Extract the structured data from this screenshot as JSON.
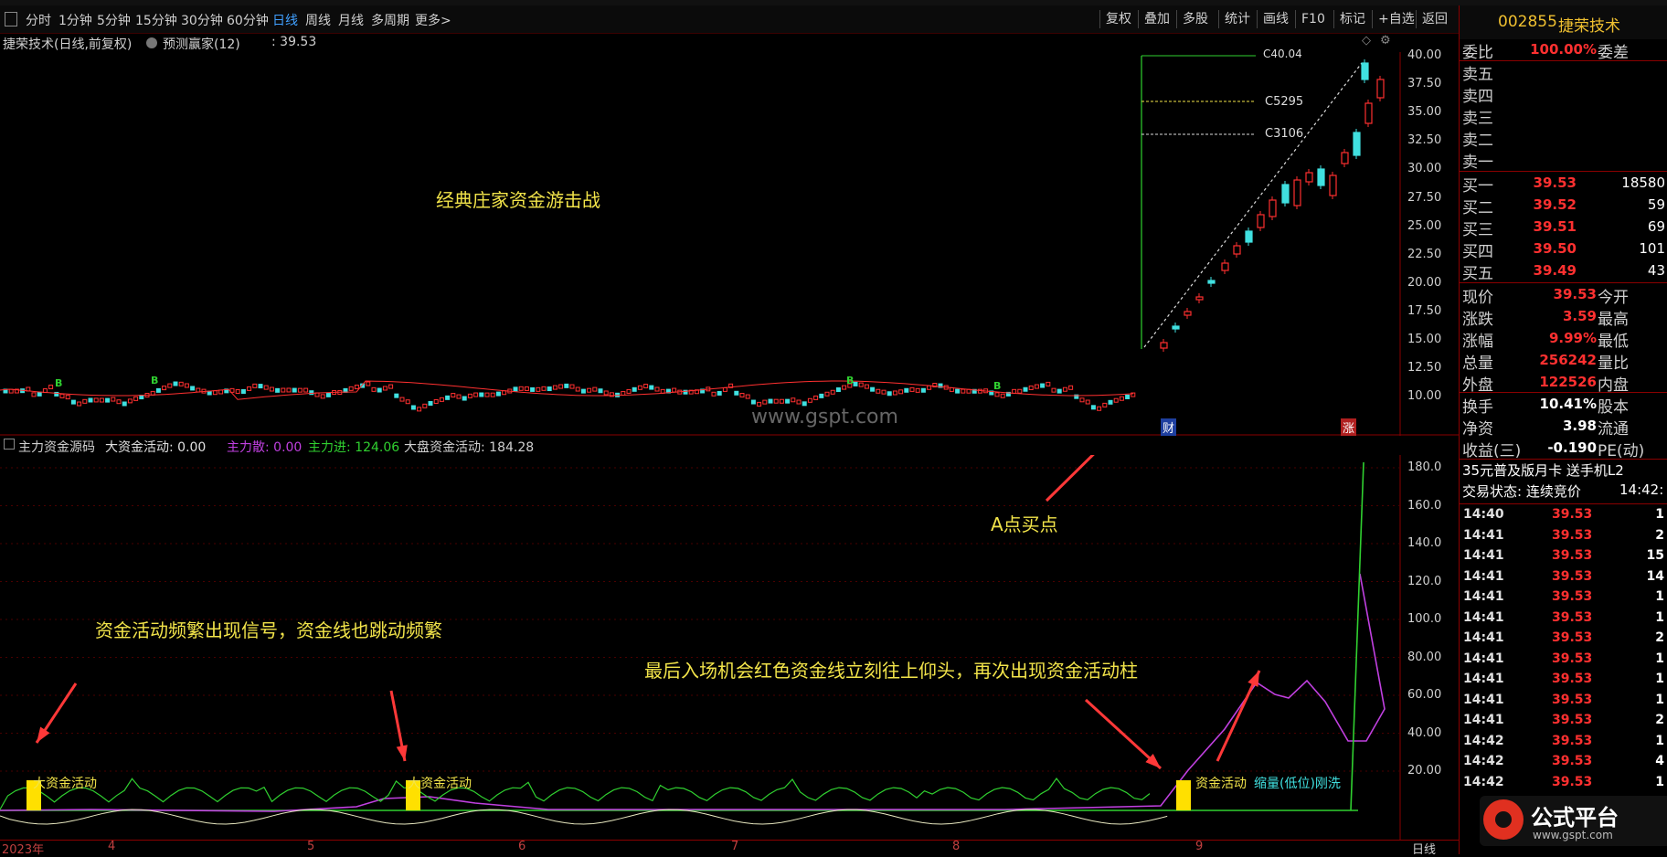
{
  "toolbar": {
    "periods": [
      "分时",
      "1分钟",
      "5分钟",
      "15分钟",
      "30分钟",
      "60分钟",
      "日线",
      "周线",
      "月线",
      "多周期",
      "更多>"
    ],
    "active_period": "日线",
    "right_buttons": [
      "复权",
      "叠加",
      "多股",
      "统计",
      "画线",
      "F10",
      "标记",
      "+自选",
      "返回"
    ]
  },
  "stock": {
    "code": "002855",
    "name": "捷荣技术"
  },
  "main_chart": {
    "title": "捷荣技术(日线,前复权)",
    "indicator": "预测赢家(12)",
    "indicator_value": ": 39.53",
    "watermark": "www.gspt.com",
    "annotation": "经典庄家资金游击战",
    "level_labels": [
      "C40.04",
      "C5295",
      "C3106"
    ],
    "b_label": "B",
    "marker_cai": "财",
    "marker_zhang": "涨",
    "y_ticks": [
      "40.00",
      "37.50",
      "35.00",
      "32.50",
      "30.00",
      "27.50",
      "25.00",
      "22.50",
      "20.00",
      "17.50",
      "15.00",
      "12.50",
      "10.00"
    ]
  },
  "sub_chart": {
    "title": "主力资金源码",
    "big_fund_label": "大资金活动: 0.00",
    "main_scatter": "主力散: 0.00",
    "main_in": "主力进: 124.06",
    "market_fund": "大盘资金活动: 184.28",
    "y_ticks": [
      "180.0",
      "160.0",
      "140.0",
      "120.0",
      "100.0",
      "80.00",
      "60.00",
      "40.00",
      "20.00"
    ],
    "bar_labels": [
      "大资金活动",
      "大资金活动",
      "资金活动"
    ],
    "shrink_label": "缩量(低位)刚洗",
    "annotation_buy": "A点买点",
    "annotation_left": "资金活动频繁出现信号，资金线也跳动频繁",
    "annotation_right": "最后入场机会红色资金线立刻往上仰头，再次出现资金活动柱"
  },
  "x_axis": {
    "labels": [
      "2023年",
      "4",
      "5",
      "6",
      "7",
      "8",
      "9"
    ],
    "period_label": "日线"
  },
  "quote": {
    "weibi": {
      "k": "委比",
      "v": "100.00%",
      "k2": "委差"
    },
    "sells": [
      "卖五",
      "卖四",
      "卖三",
      "卖二",
      "卖一"
    ],
    "buys": [
      {
        "k": "买一",
        "p": "39.53",
        "q": "18580"
      },
      {
        "k": "买二",
        "p": "39.52",
        "q": "59"
      },
      {
        "k": "买三",
        "p": "39.51",
        "q": "69"
      },
      {
        "k": "买四",
        "p": "39.50",
        "q": "101"
      },
      {
        "k": "买五",
        "p": "39.49",
        "q": "43"
      }
    ],
    "stats": [
      {
        "k": "现价",
        "v": "39.53",
        "k2": "今开"
      },
      {
        "k": "涨跌",
        "v": "3.59",
        "k2": "最高"
      },
      {
        "k": "涨幅",
        "v": "9.99%",
        "k2": "最低"
      },
      {
        "k": "总量",
        "v": "256242",
        "k2": "量比"
      },
      {
        "k": "外盘",
        "v": "122526",
        "k2": "内盘"
      }
    ],
    "stats2": [
      {
        "k": "换手",
        "v": "10.41%",
        "k2": "股本"
      },
      {
        "k": "净资",
        "v": "3.98",
        "k2": "流通"
      },
      {
        "k": "收益(三)",
        "v": "-0.190",
        "k2": "PE(动)"
      }
    ],
    "promo": "35元普及版月卡 送手机L2",
    "trade_status": "交易状态: 连续竞价",
    "trade_time": "14:42:",
    "ticks": [
      {
        "t": "14:40",
        "p": "39.53",
        "q": "1"
      },
      {
        "t": "14:41",
        "p": "39.53",
        "q": "2"
      },
      {
        "t": "14:41",
        "p": "39.53",
        "q": "15"
      },
      {
        "t": "14:41",
        "p": "39.53",
        "q": "14"
      },
      {
        "t": "14:41",
        "p": "39.53",
        "q": "1"
      },
      {
        "t": "14:41",
        "p": "39.53",
        "q": "1"
      },
      {
        "t": "14:41",
        "p": "39.53",
        "q": "2"
      },
      {
        "t": "14:41",
        "p": "39.53",
        "q": "1"
      },
      {
        "t": "14:41",
        "p": "39.53",
        "q": "1"
      },
      {
        "t": "14:41",
        "p": "39.53",
        "q": "1"
      },
      {
        "t": "14:41",
        "p": "39.53",
        "q": "2"
      },
      {
        "t": "14:42",
        "p": "39.53",
        "q": "1"
      },
      {
        "t": "14:42",
        "p": "39.53",
        "q": "4"
      },
      {
        "t": "14:42",
        "p": "39.53",
        "q": "1"
      }
    ],
    "logo_text": "公式平台",
    "logo_url": "www.gspt.com"
  },
  "colors": {
    "red": "#ff3030",
    "yellow": "#f2e44a",
    "green": "#30d030",
    "magenta": "#c040e0",
    "cyan": "#40e0e0"
  }
}
